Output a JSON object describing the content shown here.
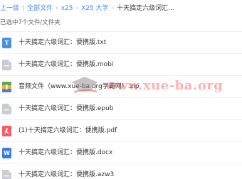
{
  "breadcrumb": {
    "back_label": "上一级",
    "items": [
      {
        "label": "全部文件"
      },
      {
        "label": "x25"
      },
      {
        "label": "X25 大学"
      }
    ],
    "current": "十天搞定六级词汇...",
    "separator": "|",
    "arrow": "›"
  },
  "selection_info": "已选中7个文件/文件夹",
  "files": [
    {
      "name": "十天搞定六级词汇：便携版.txt",
      "icon": "txt-file-icon",
      "glyph": "T"
    },
    {
      "name": "十天搞定六级词汇：便携版.mobi",
      "icon": "ebook-file-icon",
      "glyph": ""
    },
    {
      "name": "音频文件（www.xue-ba.org学霸网）.zip",
      "icon": "zip-file-icon",
      "glyph": ""
    },
    {
      "name": "十天搞定六级词汇：便携版.epub",
      "icon": "ebook-file-icon",
      "glyph": ""
    },
    {
      "name": "(1)十天搞定六级词汇：便携版.pdf",
      "icon": "pdf-file-icon",
      "glyph": "⅄"
    },
    {
      "name": "十天搞定六级词汇：便携版.docx",
      "icon": "word-file-icon",
      "glyph": "W"
    },
    {
      "name": "十天搞定六级词汇：便携版.azw3",
      "icon": "ebook-file-icon",
      "glyph": ""
    }
  ],
  "watermark": {
    "text": "www.xue-ba.org"
  },
  "colors": {
    "link": "#3b8cff",
    "txt_icon": "#4a90e2",
    "ebook_icon": "#c9ccd2",
    "zip_icon": "#f2b134",
    "pdf_icon": "#ff5a5f",
    "word_icon": "#3a7de0",
    "watermark": "#ff4646"
  }
}
